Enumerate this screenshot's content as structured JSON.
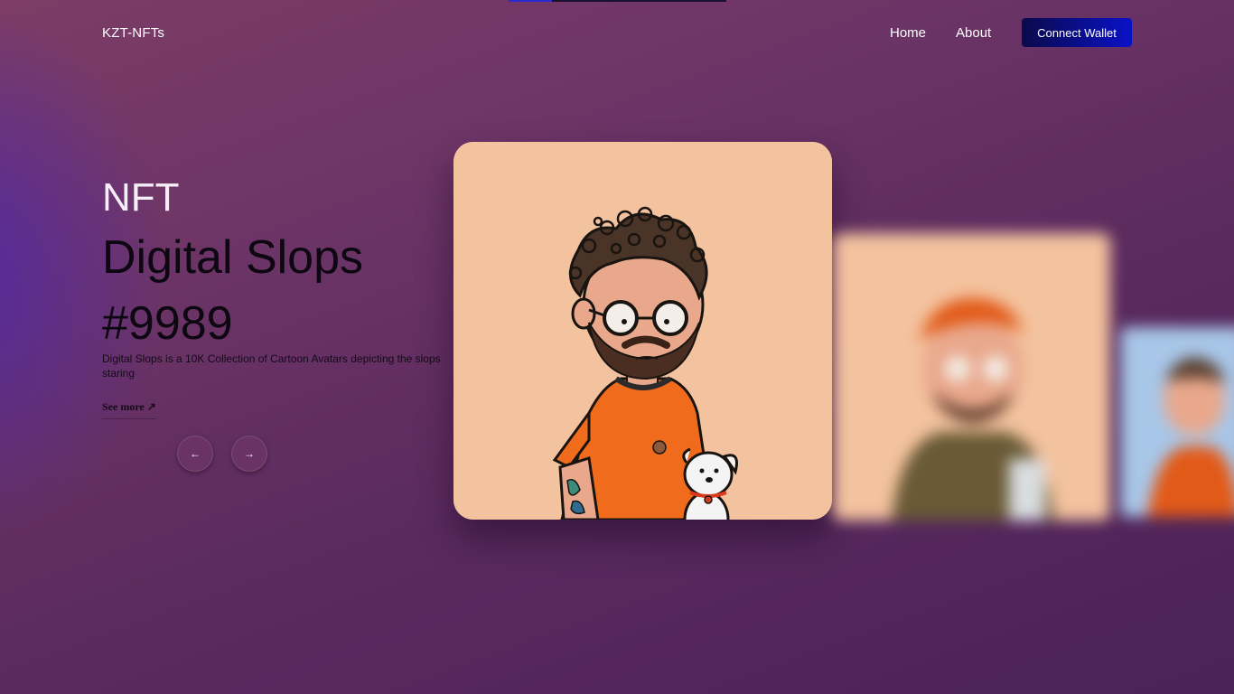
{
  "navbar": {
    "logo": "KZT-NFTs",
    "links": [
      {
        "label": "Home"
      },
      {
        "label": "About"
      }
    ],
    "connect_button": "Connect Wallet"
  },
  "page_load_progress": 0.2,
  "hero": {
    "kicker": "NFT",
    "title": "Digital Slops",
    "token": "#9989",
    "description": "Digital Slops is a 10K Collection of Cartoon Avatars depicting the slops staring",
    "see_more": "See more ↗",
    "prev_icon": "arrow-left-icon",
    "next_icon": "arrow-right-icon",
    "prev_glyph": "←",
    "next_glyph": "→"
  },
  "cards": {
    "main_background": "#f3c29e",
    "next_background": "#f3c29e",
    "third_background": "#a8c6e8"
  },
  "colors": {
    "accent_button_start": "#0a0a4a",
    "accent_button_end": "#0a12c8"
  }
}
